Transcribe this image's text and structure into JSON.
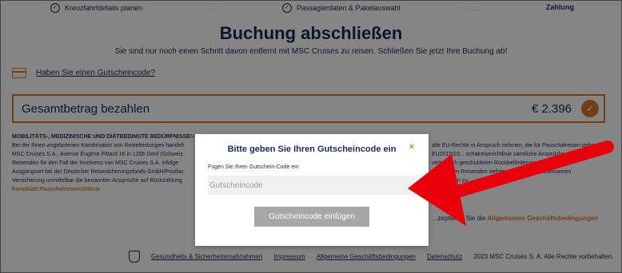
{
  "steps": [
    {
      "label": "Kreuzfahrtdetails planen",
      "done": true
    },
    {
      "label": "Passagierdaten & Paketauswahl",
      "done": true
    },
    {
      "label": "Zahlung",
      "active": true
    }
  ],
  "step_separator": "……",
  "page": {
    "title": "Buchung abschließen",
    "subtitle": "Sie sind nur noch einen Schritt davon entfernt mit MSC Cruises zu reisen. Schließen Sie jetzt Ihre Buchung ab!"
  },
  "voucher": {
    "link_text": "Haben Sie einen Gutscheincode?"
  },
  "total": {
    "label": "Gesamtbetrag bezahlen",
    "amount": "€ 2.396"
  },
  "legal": {
    "heading": "MOBILITÄTS-, MEDIZINISCHE UND DIÄTBEDINGTE BEDÜRFNISSE",
    "heading_accent": "MSC",
    "line1": "Bei der Ihnen angebotenen Kombination von Reiseleistungen handelt",
    "line1_right": "alle EU-Rechte in Anspruch nehmen, die für Pauschalreisen gelten.",
    "line2": "MSC Cruises S.A., Avenue Eugène Pittard 16 in 1206 Genf (Schweiz",
    "line2_right": "EU2015/23... schalreiserichtlinie sämtliche Ansprüche des",
    "line3": "Reisenden für den Fall der Insolvenz von MSC Cruises S.A. infolge",
    "line3_right": "vertraglich geschuldeten Rückbeförderung an den",
    "line4": "Ausgangsort bei der Deutscher Reisesicherungsfonds GmbH/Postfac",
    "line4_right": "nsert. Dem Reisenden stehen aus der abgeschlossenen",
    "line5": "Versicherung unmittelbar die benannten Ansprüche auf Rückzahlung",
    "line5_right": "ungskosten zu.",
    "form_link": "Formblatt Pauschalreiserichtlinie"
  },
  "accept": {
    "text": "...zeptieren Sie die",
    "link": "Allgemeinen Geschäftsbedingungen"
  },
  "footer": {
    "links": [
      "Gesundheits & Sicherheitsmaßnahmen",
      "Impressum",
      "Allgemeine Geschäftsbedingungen",
      "Datenschutz"
    ],
    "copyright": "2023 MSC Cruises S. A. Alle Rechte vorbehalten."
  },
  "modal": {
    "title": "Bitte geben Sie Ihren Gutscheincode ein",
    "close": "×",
    "field_label": "Fügen Sie Ihren Gutschein-Code ein",
    "field_placeholder": "Gutscheincode",
    "field_value": "",
    "submit_label": "Gutscheincode einfügen"
  },
  "colors": {
    "accent": "#e07a2b",
    "navy": "#1a2a55",
    "arrow": "#e8000b",
    "button_disabled": "#a7a7a7"
  }
}
